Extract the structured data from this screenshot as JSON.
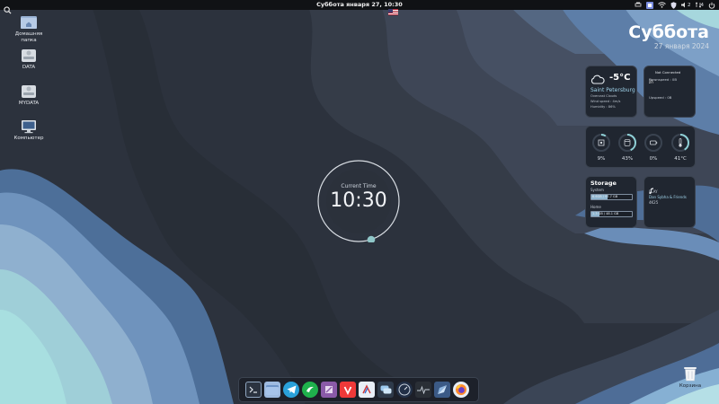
{
  "top_panel": {
    "clock": "Суббота января 27, 10:30",
    "icons": [
      "search-icon",
      "flag-us-icon",
      "printer-icon",
      "app-icon",
      "wifi-icon",
      "shield-icon",
      "volume-icon",
      "network-icon",
      "power-icon"
    ],
    "volume_text": "2",
    "net_text": "4"
  },
  "desktop": {
    "icons": [
      {
        "label": "Домашняя папка",
        "icon": "home-folder-icon"
      },
      {
        "label": "DATA",
        "icon": "drive-icon"
      },
      {
        "label": "MYDATA",
        "icon": "drive-icon"
      },
      {
        "label": "Компьютер",
        "icon": "computer-icon"
      }
    ],
    "trash_label": "Корзина"
  },
  "date_widget": {
    "day": "Суббота",
    "date": "27 января 2024"
  },
  "weather": {
    "temp": "-5°C",
    "city": "Saint Petersburg",
    "condition": "Overcast Clouds",
    "wind": "Wind speed : 4m/s",
    "humidity": "Humidity : 86%"
  },
  "network": {
    "status": "Not Connected",
    "downspeed": "Downspeed : 0B",
    "upspeed": "Upspeed : 0B"
  },
  "system": {
    "gauges": [
      {
        "name": "cpu",
        "value": "9%",
        "fraction": 0.09
      },
      {
        "name": "memory",
        "value": "43%",
        "fraction": 0.43
      },
      {
        "name": "battery",
        "value": "0%",
        "fraction": 0.0
      },
      {
        "name": "temperature",
        "value": "41°C",
        "fraction": 0.41
      }
    ]
  },
  "storage": {
    "title": "Storage",
    "system_label": "System",
    "system_value": "6.6GB / 97.7 GB",
    "system_fraction": 0.4,
    "home_label": "Home",
    "home_value": "1.3 GB / 48.1 GB",
    "home_fraction": 0.2
  },
  "music": {
    "state": "PLAY",
    "artist": "Dan Sybha & Friends",
    "track": "4K25"
  },
  "center_clock": {
    "label": "Current Time",
    "time": "10:30",
    "progress": 0.5
  },
  "dock": {
    "apps": [
      "terminal-icon",
      "files-icon",
      "telegram-icon",
      "green-app-icon",
      "purple-app-icon",
      "vivaldi-icon",
      "writer-icon",
      "chat-icon",
      "system-monitor-icon",
      "activity-icon",
      "kite-icon",
      "firefox-icon"
    ]
  },
  "colors": {
    "accent": "#8fd0d6",
    "panel": "#101215",
    "card": "#202630"
  }
}
